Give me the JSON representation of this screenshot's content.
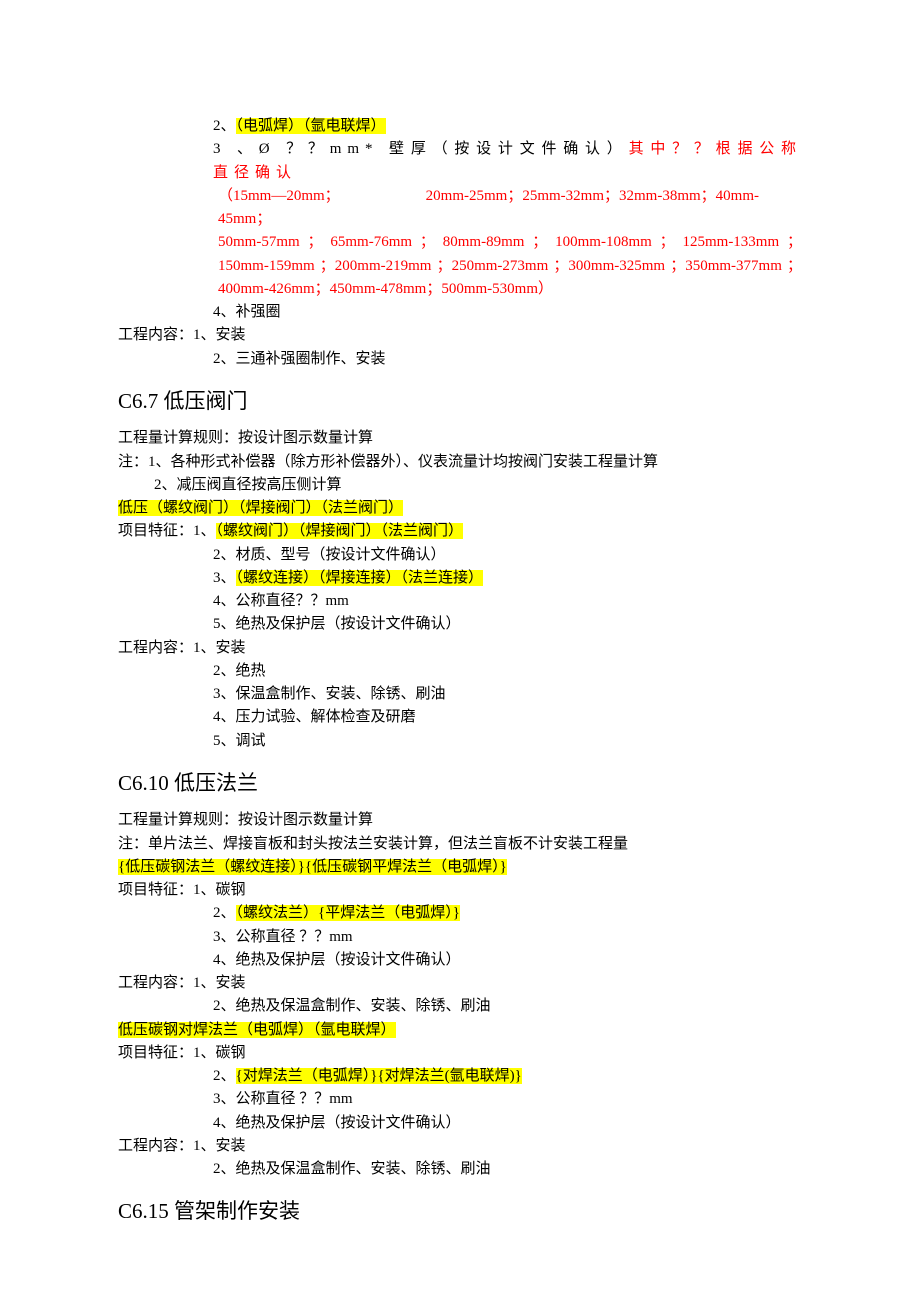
{
  "top": {
    "item2_prefix": "2、",
    "item2_hl": "（电弧焊）（氩电联焊）",
    "item3_a_black": "3 、Ø ？？mm* 壁厚（按设计文件确认）",
    "item3_a_red": "其中？？根据公称直径确认",
    "item3_b_red_1": "（15mm—20mm；",
    "item3_b_red_2": "20mm-25mm；25mm-32mm；32mm-38mm；40mm-45mm；",
    "item3_c_red": "50mm-57mm ； 65mm-76mm ； 80mm-89mm ； 100mm-108mm ； 125mm-133mm ；150mm-159mm ；200mm-219mm ；250mm-273mm ；300mm-325mm ；350mm-377mm ；400mm-426mm；450mm-478mm；500mm-530mm）",
    "item4": "4、补强圈",
    "gcn_label": "工程内容：1、安装",
    "gcn_2": "2、三通补强圈制作、安装"
  },
  "c67": {
    "heading": "C6.7  低压阀门",
    "rule": "工程量计算规则：按设计图示数量计算",
    "note1": "注：1、各种形式补偿器（除方形补偿器外）、仪表流量计均按阀门安装工程量计算",
    "note2_indent": "2、减压阀直径按高压侧计算",
    "hl_line": "低压（螺纹阀门）（焊接阀门）（法兰阀门）",
    "feat_label": "项目特征：1、",
    "feat1_hl": "（螺纹阀门）（焊接阀门）（法兰阀门）",
    "feat2": "2、材质、型号（按设计文件确认）",
    "feat3_prefix": "3、",
    "feat3_hl": "（螺纹连接）（焊接连接）（法兰连接）",
    "feat4": "4、公称直径？？mm",
    "feat5": "5、绝热及保护层（按设计文件确认）",
    "gcn_label": "工程内容：1、安装",
    "gcn2": "2、绝热",
    "gcn3": "3、保温盒制作、安装、除锈、刷油",
    "gcn4": "4、压力试验、解体检查及研磨",
    "gcn5": "5、调试"
  },
  "c610": {
    "heading": "C6.10  低压法兰",
    "rule": "工程量计算规则：按设计图示数量计算",
    "note": "注：单片法兰、焊接盲板和封头按法兰安装计算，但法兰盲板不计安装工程量",
    "hl_line1": "{低压碳钢法兰（螺纹连接）}{低压碳钢平焊法兰（电弧焊）}",
    "feat_label": "项目特征：1、碳钢",
    "feat2_prefix": "2、",
    "feat2_hl": "（螺纹法兰）{平焊法兰（电弧焊）}",
    "feat3": "3、公称直径 ？？mm",
    "feat4": "4、绝热及保护层（按设计文件确认）",
    "gcn_label": "工程内容：1、安装",
    "gcn2": "2、绝热及保温盒制作、安装、除锈、刷油",
    "hl_line2": "低压碳钢对焊法兰（电弧焊）（氩电联焊）",
    "feat_label2": "项目特征：1、碳钢",
    "feat2b_prefix": "2、",
    "feat2b_hl": "{对焊法兰（电弧焊）}{对焊法兰(氩电联焊)}",
    "feat3b": "3、公称直径 ？？mm",
    "feat4b": "4、绝热及保护层（按设计文件确认）",
    "gcn_label2": "工程内容：1、安装",
    "gcn2b": "2、绝热及保温盒制作、安装、除锈、刷油"
  },
  "c615": {
    "heading": "C6.15  管架制作安装"
  }
}
